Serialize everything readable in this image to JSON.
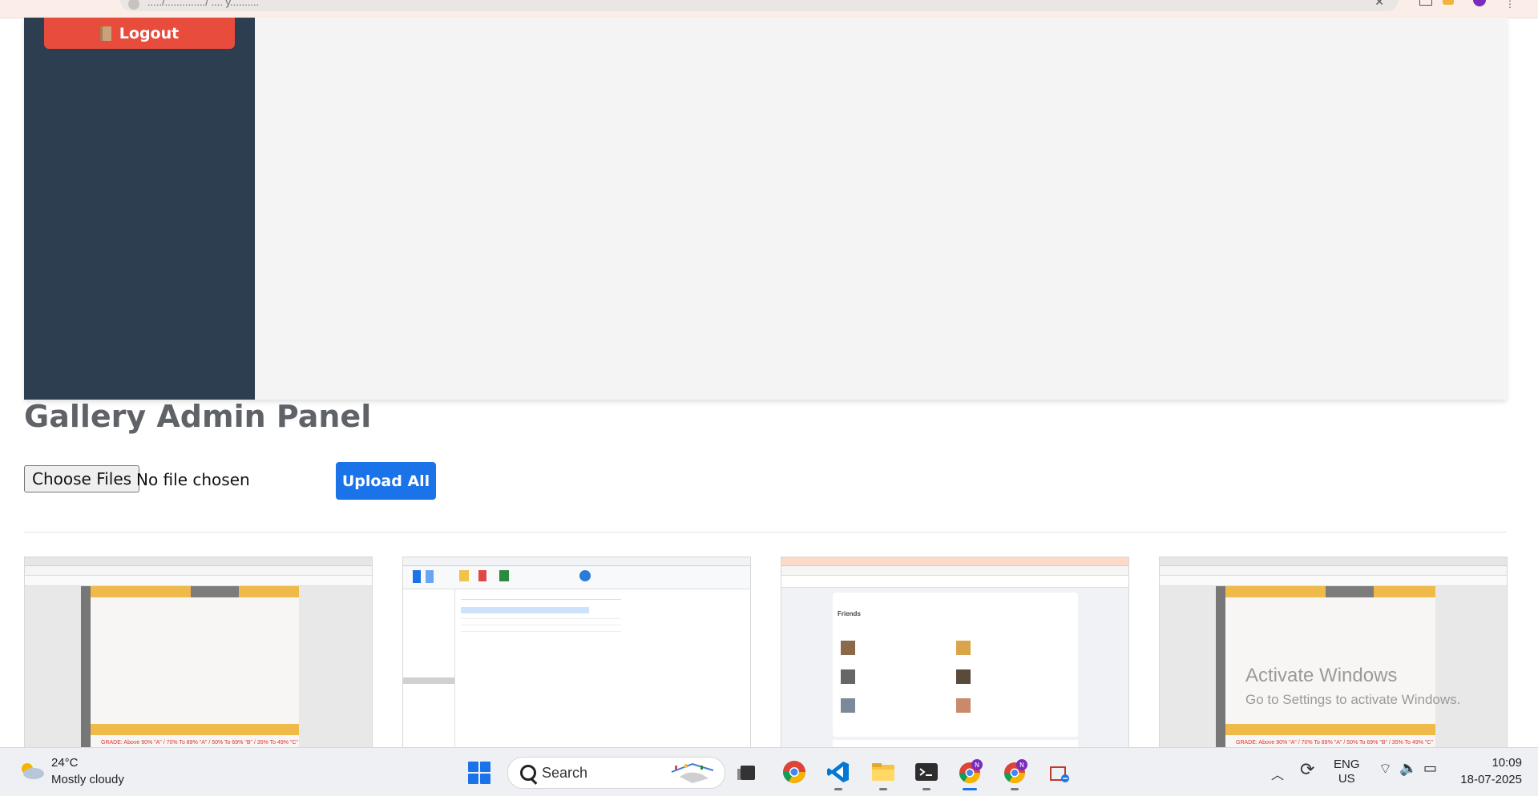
{
  "browser": {
    "address_text": "...../............../ .... y..........",
    "accent": "#7b2cbf"
  },
  "sidebar": {
    "logout_label": "Logout",
    "logout_icon": "door-icon",
    "bg_color": "#2c3e50",
    "logout_color": "#e74c3c"
  },
  "main": {
    "title": "Gallery Admin Panel",
    "choose_files_label": "Choose Files",
    "file_status": "No file chosen",
    "upload_label": "Upload All",
    "upload_color": "#1a73e8"
  },
  "gallery": {
    "thumbnails": [
      {
        "caption": "GRADE: Above 90% \"A\" / 70% To 89% \"A\" / 50% To 69% \"B\" / 35% To 49% \"C\""
      },
      {
        "caption": ""
      },
      {
        "caption": "Friends"
      },
      {
        "caption": "GRADE: Above 90% \"A\" / 70% To 89% \"A\" / 50% To 69% \"B\" / 35% To 49% \"C\""
      }
    ]
  },
  "watermark": {
    "title": "Activate Windows",
    "subtitle": "Go to Settings to activate Windows."
  },
  "taskbar": {
    "weather_temp": "24°C",
    "weather_condition": "Mostly cloudy",
    "search_label": "Search",
    "lang_line1": "ENG",
    "lang_line2": "US",
    "time": "10:09",
    "date": "18-07-2025",
    "apps": [
      "start-icon",
      "search-icon",
      "task-view-icon",
      "chrome-icon",
      "vscode-icon",
      "file-explorer-icon",
      "terminal-icon",
      "chrome-profile-icon",
      "chrome-profile-icon",
      "snipping-tool-icon"
    ]
  }
}
